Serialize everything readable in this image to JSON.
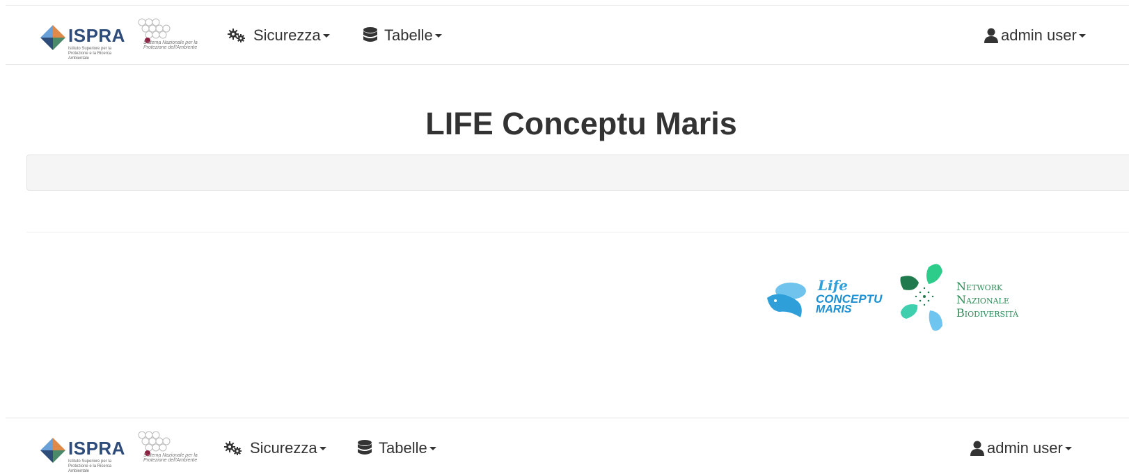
{
  "navbar": {
    "brand": {
      "ispra_name": "ISPRA",
      "ispra_subtitle": "Istituto Superiore per la Protezione e la Ricerca Ambientale",
      "snpa_subtitle": "Sistema Nazionale per la Protezione dell'Ambiente"
    },
    "menu_security": "Sicurezza",
    "menu_tables": "Tabelle",
    "user_menu": "admin user"
  },
  "main": {
    "title": "LIFE Conceptu Maris"
  },
  "footer_logos": {
    "life_line1": "Life",
    "life_line2": "CONCEPTU",
    "life_line3": "MARIS",
    "network_line1": "Network",
    "network_line2": "Nazionale",
    "network_line3": "Biodiversità"
  },
  "colors": {
    "brand_blue": "#2e4c7a",
    "life_blue": "#1b8fd2",
    "network_green": "#2e8b57"
  },
  "icons": {
    "security": "cogs-icon",
    "tables": "database-icon",
    "user": "user-icon"
  }
}
